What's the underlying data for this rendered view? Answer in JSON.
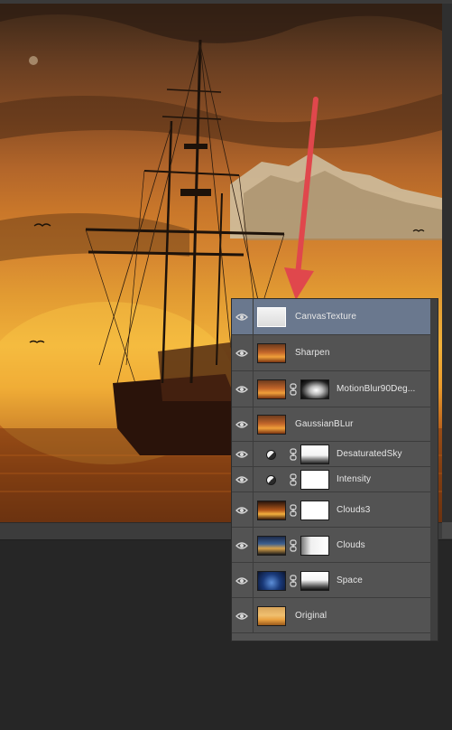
{
  "layers_panel": {
    "layers": [
      {
        "name": "CanvasTexture",
        "selected": true,
        "thumb": "white-texture",
        "mask": false,
        "adjustment": false
      },
      {
        "name": "Sharpen",
        "selected": false,
        "thumb": "ship-sunset",
        "mask": false,
        "adjustment": false
      },
      {
        "name": "MotionBlur90Deg...",
        "selected": false,
        "thumb": "ship-sunset",
        "mask": true,
        "adjustment": false
      },
      {
        "name": "GaussianBLur",
        "selected": false,
        "thumb": "ship-sunset",
        "mask": false,
        "adjustment": false
      },
      {
        "name": "DesaturatedSky",
        "selected": false,
        "thumb": "adjustment",
        "mask": true,
        "adjustment": true
      },
      {
        "name": "Intensity",
        "selected": false,
        "thumb": "adjustment",
        "mask": true,
        "adjustment": true
      },
      {
        "name": "Clouds3",
        "selected": false,
        "thumb": "clouds-sunset",
        "mask": true,
        "adjustment": false
      },
      {
        "name": "Clouds",
        "selected": false,
        "thumb": "clouds-blue",
        "mask": true,
        "adjustment": false
      },
      {
        "name": "Space",
        "selected": false,
        "thumb": "space-blue",
        "mask": true,
        "adjustment": false
      },
      {
        "name": "Original",
        "selected": false,
        "thumb": "ship-original",
        "mask": false,
        "adjustment": false
      }
    ]
  },
  "colors": {
    "panel_bg": "#535353",
    "selected_row": "#6a788e",
    "annotation_arrow": "#e0474c",
    "workspace_bg": "#262626"
  }
}
